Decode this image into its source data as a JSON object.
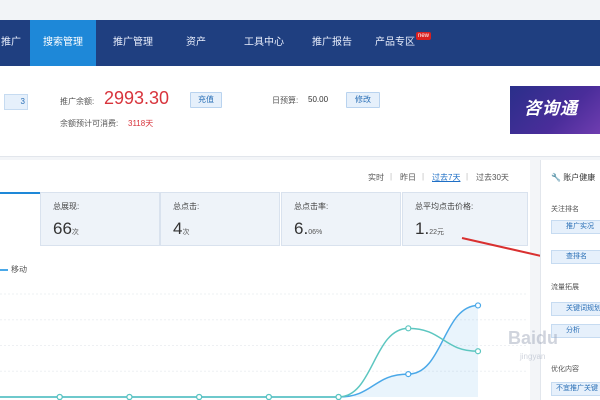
{
  "nav": {
    "items": [
      "推广",
      "搜索管理",
      "推广管理",
      "资产",
      "工具中心",
      "推广报告",
      "产品专区"
    ],
    "new_badge": "new"
  },
  "account": {
    "side_value": "3",
    "balance_label": "推广余额:",
    "balance_value": "2993.30",
    "recharge_button": "充值",
    "daily_budget_label": "日预算:",
    "daily_budget_value": "50.00",
    "edit_button": "修改",
    "remaining_label": "余额预计可消费:",
    "remaining_value": "3118天"
  },
  "banner": {
    "text": "咨询通"
  },
  "date_ranges": [
    "实时",
    "昨日",
    "过去7天",
    "过去30天"
  ],
  "active_range": "过去7天",
  "stats": [
    {
      "label": "总展现:",
      "value": "66",
      "unit": "次"
    },
    {
      "label": "总点击:",
      "value": "4",
      "unit": "次"
    },
    {
      "label": "总点击率:",
      "value": "6.",
      "unit": "06%"
    },
    {
      "label": "总平均点击价格:",
      "value": "1.",
      "unit": "22元"
    }
  ],
  "chart_legend": "移动",
  "sidebar": {
    "title": "账户健康",
    "section1": "关注排名",
    "btn1": "推广实况",
    "btn2": "查排名",
    "section2": "流量拓展",
    "btn3": "关键词规划",
    "btn4": "分析",
    "section3": "优化内容",
    "btn5": "不宜推广关键"
  },
  "watermark": {
    "logo": "Baidu",
    "sub": "jingyan"
  },
  "colors": {
    "nav_bg": "#1f3f80",
    "nav_active": "#1e88d8",
    "balance": "#d8343c",
    "series_blue": "#4aa8e8",
    "series_teal": "#5cc6c0"
  },
  "chart_data": {
    "type": "line",
    "x": [
      1,
      2,
      3,
      4,
      5,
      6,
      7,
      8
    ],
    "series": [
      {
        "values": [
          0,
          0,
          0,
          0,
          0,
          0,
          1,
          4
        ]
      },
      {
        "values": [
          0,
          0,
          0,
          0,
          0,
          0,
          3,
          2
        ]
      }
    ],
    "ylim": [
      0,
      4.5
    ],
    "grid": true
  }
}
